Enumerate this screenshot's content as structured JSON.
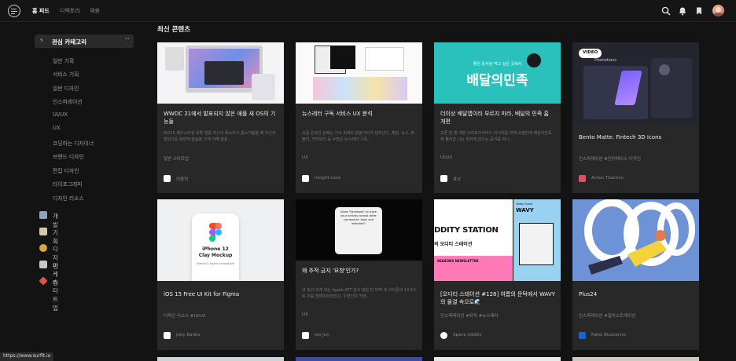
{
  "topbar": {
    "logo_icon": "surfit-logo-icon",
    "nav": [
      "홈 피드",
      "디렉토리",
      "채용"
    ],
    "icons": [
      "search-icon",
      "bell-icon",
      "bookmark-icon"
    ]
  },
  "sidebar": {
    "category_header": "관심 카테고리",
    "more": "···",
    "sub_items": [
      "일반 기획",
      "서비스 기획",
      "일반 디자인",
      "인스퍼레이션",
      "UI/UX",
      "UX",
      "코딩하는 디자이너",
      "브랜드 디자인",
      "편집 디자인",
      "타이포그래피",
      "디자인 리소스"
    ],
    "main_categories": [
      {
        "label": "개발",
        "icon": "monitor-icon",
        "color": "#8fa3b8"
      },
      {
        "label": "기획",
        "icon": "memo-icon",
        "color": "#d6c9a8"
      },
      {
        "label": "디자인",
        "icon": "palette-icon",
        "color": "#d9a441"
      },
      {
        "label": "마케팅",
        "icon": "megaphone-icon",
        "color": "#c7c7c7"
      },
      {
        "label": "스타트업",
        "icon": "rocket-icon",
        "color": "#d9534f"
      }
    ]
  },
  "section_title": "최신 콘텐츠",
  "cards": [
    {
      "title": "WWDC 21에서 발표되지 않은 애플 새 OS의 기능들",
      "desc": "iOS15 페이스타임 유튜 발럼 자신의 목소리가 음소거됨을 때 자신의 발란다운 화면에 말씀을 크게 이해 말원...",
      "tags": "일반 스타트업",
      "author": "이종혁",
      "author_color": "#ffffff"
    },
    {
      "title": "뉴스레터 구독 서비스 UX 분석",
      "desc": "요즘 온라인 상에는 가서 회체도 읽을거리가 넘쳐난다. 채팅, 뉴스, 퍼블리, 카카오티 등 수많은 뉴스레터 구독...",
      "tags": "UX",
      "author": "insight coco",
      "author_color": "#ffffff"
    },
    {
      "title": "더이상 배달앱이라 부르지 마라, 배달의 민족 홈 개편",
      "desc": "오픈 전 홈 개편 이리보기서비스 리서치를 위해 오랜만에 배달의민족에 들어간 나는 획하게 만드는 공지를 하나...",
      "tags": "UI/UX",
      "author": "효낭",
      "author_color": "#ffffff"
    },
    {
      "title": "Bento Matte. Fintech 3D Icons",
      "desc": "",
      "tags": "인스퍼레이션  #인터페이스 디자인",
      "author": "Anton Tkachev",
      "author_color": "#e04e6a"
    },
    {
      "title": "iOS 15 Free UI Kit for Figma",
      "desc": "",
      "tags": "디자인 리소스  #UI/UX",
      "author": "Joey Banks",
      "author_color": "#ffffff"
    },
    {
      "title": "왜 추적 금지 '요청'인가?",
      "desc": "넷 놓고 보게 되는 Apple ATT 광고 레임 만 마찍 세 이이폰의 14.5으로 처음 업데이트되었고, 우연인지 어떤...",
      "tags": "UX",
      "author": "Joe Jun",
      "author_color": "#ffffff"
    },
    {
      "title": "[오디티 스테이션 #128] 여름의 문턱에서 WAVY의 물결 속으로🌊",
      "desc": "",
      "tags": "인스퍼레이션  #뮤직  #뉴스레터",
      "author": "Space Oddity",
      "author_color": "#ffffff"
    },
    {
      "title": "Plus24",
      "desc": "",
      "tags": "인스퍼레이션  #일러스트레이션",
      "author": "Fabio Buonanno",
      "author_color": "#1f5fd1"
    }
  ],
  "thumbs": {
    "baemin_caption": "좋은 음식을 먹고 싶은 곳에서",
    "baemin_brand": "배달의민족",
    "video_badge": "VIDEO",
    "video_subtitle": "Promotions",
    "phone_label": "iPhone 12\nClay Mockup",
    "phone_sub": "Sketch & Figma compatible",
    "att_dialog": "Allow \"Facebook\" to track your activity across other companies' apps and websites?",
    "oddity_title": "DDITY STATION",
    "oddity_kr": "의 오디티 스테이션",
    "oddity_news": "SEASONS NEWSLETTER",
    "wavy": "WAVY",
    "wavy_sub": "Today Guest"
  },
  "status_url": "https://www.surfit.io"
}
